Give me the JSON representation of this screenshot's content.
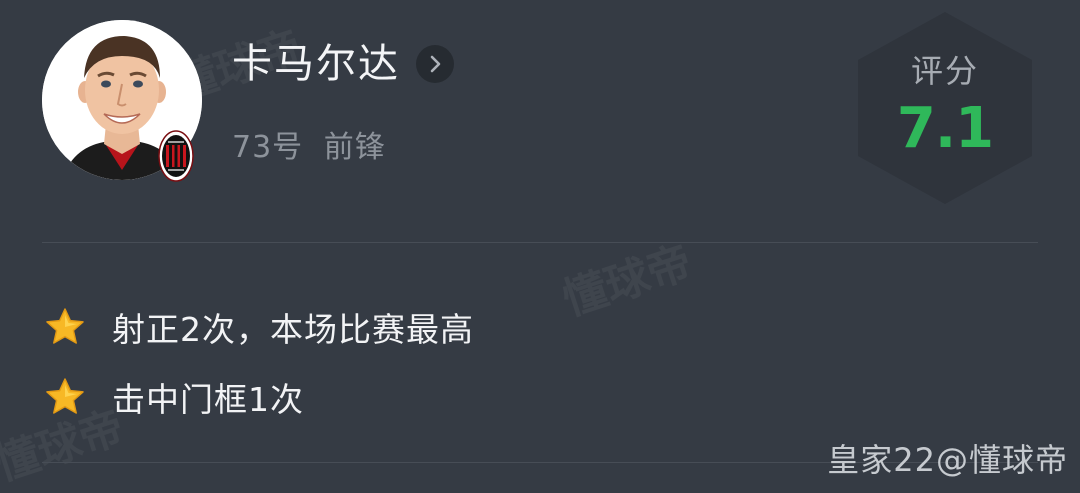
{
  "player": {
    "name": "卡马尔达",
    "number": "73号",
    "position": "前锋"
  },
  "rating": {
    "label": "评分",
    "value": "7.1",
    "color": "#2fb85a"
  },
  "highlights": [
    {
      "icon": "star-icon",
      "text": "射正2次，本场比赛最高"
    },
    {
      "icon": "star-icon",
      "text": "击中门框1次"
    }
  ],
  "watermark": {
    "text": "懂球帝",
    "credit": "皇家22@懂球帝"
  },
  "colors": {
    "background": "#353b44",
    "divider": "#474d56",
    "muted_text": "#8d939b",
    "star": "#f7b825"
  }
}
